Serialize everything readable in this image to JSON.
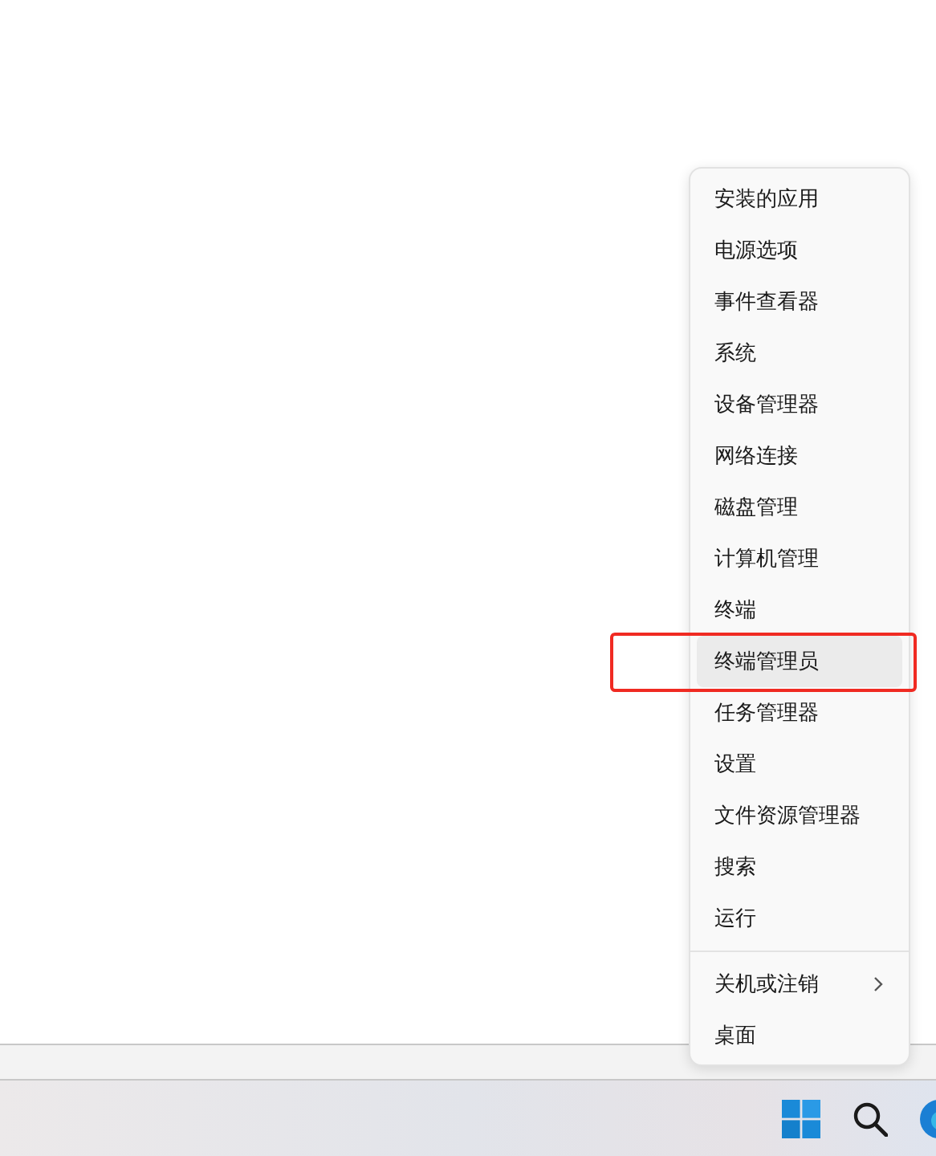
{
  "context_menu": {
    "sections": [
      {
        "items": [
          {
            "label": "安装的应用",
            "kind": "item",
            "selected": false,
            "callout": false
          },
          {
            "label": "电源选项",
            "kind": "item",
            "selected": false,
            "callout": false
          },
          {
            "label": "事件查看器",
            "kind": "item",
            "selected": false,
            "callout": false
          },
          {
            "label": "系统",
            "kind": "item",
            "selected": false,
            "callout": false
          },
          {
            "label": "设备管理器",
            "kind": "item",
            "selected": false,
            "callout": false
          },
          {
            "label": "网络连接",
            "kind": "item",
            "selected": false,
            "callout": false
          },
          {
            "label": "磁盘管理",
            "kind": "item",
            "selected": false,
            "callout": false
          },
          {
            "label": "计算机管理",
            "kind": "item",
            "selected": false,
            "callout": false
          },
          {
            "label": "终端",
            "kind": "item",
            "selected": false,
            "callout": false
          },
          {
            "label": "终端管理员",
            "kind": "item",
            "selected": true,
            "callout": true
          },
          {
            "label": "任务管理器",
            "kind": "item",
            "selected": false,
            "callout": false
          },
          {
            "label": "设置",
            "kind": "item",
            "selected": false,
            "callout": false
          },
          {
            "label": "文件资源管理器",
            "kind": "item",
            "selected": false,
            "callout": false
          },
          {
            "label": "搜索",
            "kind": "item",
            "selected": false,
            "callout": false
          },
          {
            "label": "运行",
            "kind": "item",
            "selected": false,
            "callout": false
          }
        ]
      },
      {
        "items": [
          {
            "label": "关机或注销",
            "kind": "submenu",
            "selected": false,
            "callout": false
          },
          {
            "label": "桌面",
            "kind": "item",
            "selected": false,
            "callout": false
          }
        ]
      }
    ]
  },
  "taskbar": {
    "icons": [
      {
        "kind": "start"
      },
      {
        "kind": "search"
      },
      {
        "kind": "browser"
      }
    ]
  }
}
